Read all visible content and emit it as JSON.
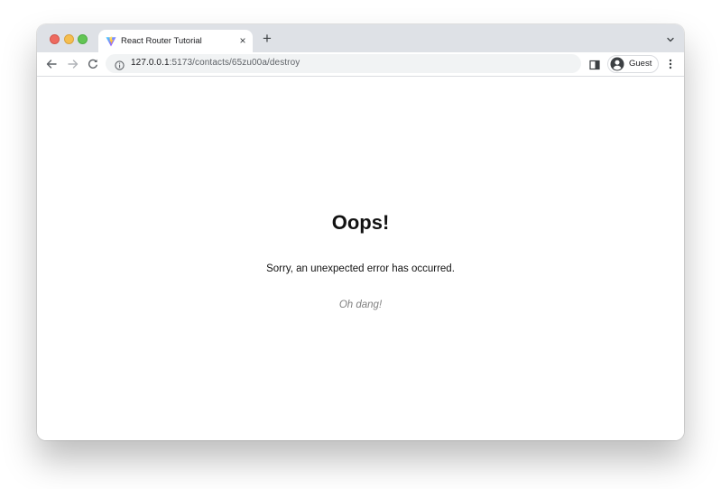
{
  "browser": {
    "tab": {
      "title": "React Router Tutorial",
      "favicon": "vite-logo-icon",
      "close_glyph": "×"
    },
    "new_tab_glyph": "+",
    "address_bar": {
      "host": "127.0.0.1",
      "path": ":5173/contacts/65zu00a/destroy"
    },
    "profile": {
      "label": "Guest"
    },
    "colors": {
      "tabstrip": "#dee1e6",
      "omnibox": "#f1f3f4",
      "close": "#ee6a5f",
      "minimize": "#f5be4f",
      "maximize": "#62c554"
    }
  },
  "page": {
    "heading": "Oops!",
    "message": "Sorry, an unexpected error has occurred.",
    "detail": "Oh dang!",
    "colors": {
      "heading": "#121212",
      "detail": "#818181"
    }
  }
}
